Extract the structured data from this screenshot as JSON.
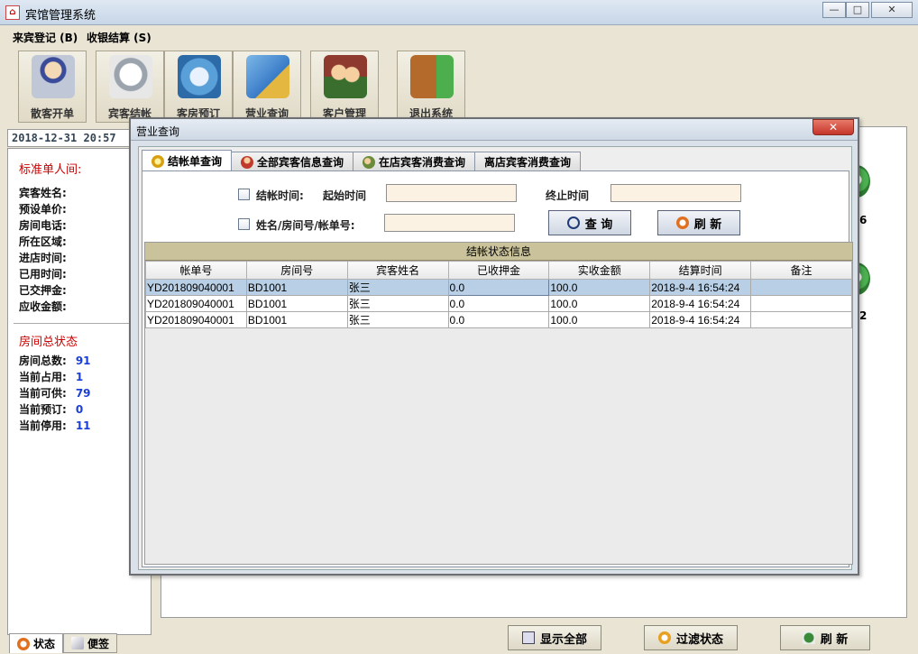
{
  "window": {
    "title": "宾馆管理系统",
    "min": "—",
    "max": "□",
    "close": "✕"
  },
  "menu": {
    "items": [
      "来宾登记 (B)",
      "收银结算 (S)"
    ]
  },
  "toolbar": [
    {
      "label": "散客开单",
      "icon": "guest-register-icon"
    },
    {
      "label": "宾客结帐",
      "icon": "checkout-icon"
    },
    {
      "label": "客房预订",
      "icon": "room-booking-icon"
    },
    {
      "label": "营业查询",
      "icon": "business-query-icon"
    },
    {
      "label": "客户管理",
      "icon": "customer-manage-icon"
    },
    {
      "label": "退出系统",
      "icon": "exit-icon"
    }
  ],
  "datetime": "2018-12-31  20:57",
  "left": {
    "room_type_title": "标准单人间:",
    "fields": [
      "宾客姓名:",
      "预设单价:",
      "房间电话:",
      "所在区域:",
      "进店时间:",
      "已用时间:",
      "已交押金:",
      "应收金额:"
    ],
    "status_title": "房间总状态",
    "stats": [
      {
        "label": "房间总数:",
        "value": "91"
      },
      {
        "label": "当前占用:",
        "value": "1"
      },
      {
        "label": "当前可供:",
        "value": "79"
      },
      {
        "label": "当前预订:",
        "value": "0"
      },
      {
        "label": "当前停用:",
        "value": "11"
      }
    ],
    "tabs": [
      "状态",
      "便签"
    ]
  },
  "right": {
    "room_nums": [
      "6",
      "2"
    ]
  },
  "bottom_buttons": [
    "显示全部",
    "过滤状态",
    "刷  新"
  ],
  "dialog": {
    "title": "营业查询",
    "close": "✕",
    "tabs": [
      "结帐单查询",
      "全部宾客信息查询",
      "在店宾客消费查询",
      "离店宾客消费查询"
    ],
    "filters": {
      "checkout_time": "结帐时间:",
      "start": "起始时间",
      "end": "终止时间",
      "name_room": "姓名/房间号/帐单号:"
    },
    "query_button": "查  询",
    "refresh_button": "刷  新",
    "grid_caption": "结帐状态信息",
    "columns": [
      "帐单号",
      "房间号",
      "宾客姓名",
      "已收押金",
      "实收金额",
      "结算时间",
      "备注"
    ],
    "rows": [
      [
        "YD201809040001",
        "BD1001",
        "张三",
        "0.0",
        "100.0",
        "2018-9-4 16:54:24",
        ""
      ],
      [
        "YD201809040001",
        "BD1001",
        "张三",
        "0.0",
        "100.0",
        "2018-9-4 16:54:24",
        ""
      ],
      [
        "YD201809040001",
        "BD1001",
        "张三",
        "0.0",
        "100.0",
        "2018-9-4 16:54:24",
        ""
      ]
    ]
  },
  "colors": {
    "accent_red": "#cc0000",
    "value_blue": "#1a3ed8",
    "selection": "#b8cfe5"
  }
}
